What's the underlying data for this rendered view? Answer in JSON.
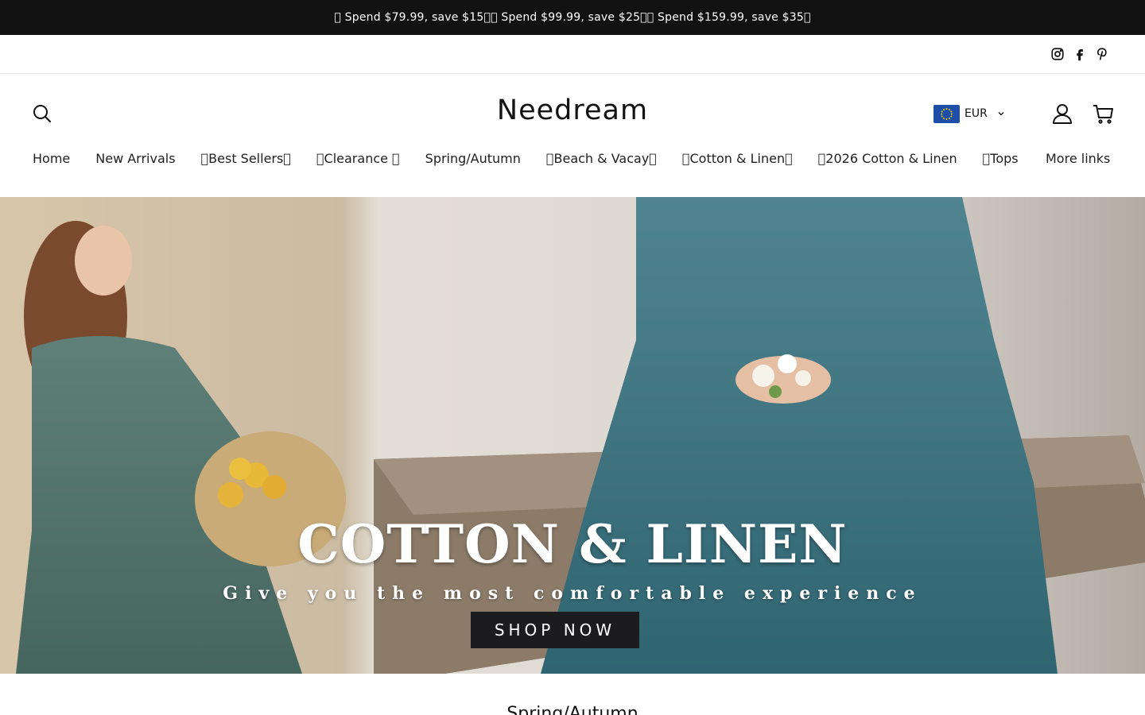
{
  "announcement": {
    "text": "\u0000 Spend $79.99, save $15\u0000\u0000 Spend $99.99, save $25\u0000\u0000 Spend $159.99, save $35\u0000"
  },
  "social": {
    "icons": [
      "instagram-icon",
      "facebook-icon",
      "pinterest-icon"
    ]
  },
  "header": {
    "logo": "Needream",
    "currency": "EUR",
    "icons": [
      "search-icon",
      "eu-flag-icon",
      "chevron-down-icon",
      "account-icon",
      "cart-icon"
    ]
  },
  "nav": {
    "items": [
      {
        "label": "Home"
      },
      {
        "label": "New Arrivals"
      },
      {
        "label": "\u0000Best Sellers\u0000"
      },
      {
        "label": "\u0000Clearance \u0000"
      },
      {
        "label": "Spring/Autumn"
      },
      {
        "label": "\u0000Beach & Vacay\u0000"
      },
      {
        "label": "\u0000Cotton & Linen\u0000"
      },
      {
        "label": "\u00002026 Cotton & Linen"
      },
      {
        "label": "\u0000Tops"
      },
      {
        "label": "More links"
      }
    ]
  },
  "hero": {
    "title": "COTTON & LINEN",
    "subtitle": "Give you the most comfortable experience",
    "button": "SHOP NOW"
  },
  "section": {
    "heading": "Spring/Autumn"
  },
  "colors": {
    "announcement_bg": "#121212",
    "button_bg": "#1c1b1d",
    "text": "#121212"
  }
}
